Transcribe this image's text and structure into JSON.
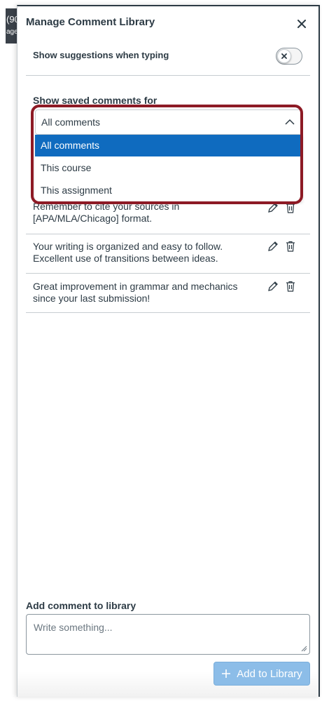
{
  "background": {
    "text_top": "(90",
    "text_bottom": "age"
  },
  "panel": {
    "title": "Manage Comment Library",
    "close_icon": "close-icon"
  },
  "suggestions": {
    "label": "Show suggestions when typing",
    "toggle_state": "off"
  },
  "filter": {
    "label": "Show saved comments for",
    "selected": "All comments",
    "options": [
      "All comments",
      "This course",
      "This assignment"
    ]
  },
  "comments": [
    {
      "text": "Remember to cite your sources in [APA/MLA/Chicago] format."
    },
    {
      "text": "Your writing is organized and easy to follow. Excellent use of transitions between ideas."
    },
    {
      "text": "Great improvement in grammar and mechanics since your last submission!"
    }
  ],
  "add": {
    "label": "Add comment to library",
    "placeholder": "Write something...",
    "button_label": "Add to Library"
  },
  "colors": {
    "selected_option": "#0f6bbf",
    "highlight_border": "#8d1a25",
    "add_button": "#8cbde8",
    "text": "#2d3b45"
  }
}
